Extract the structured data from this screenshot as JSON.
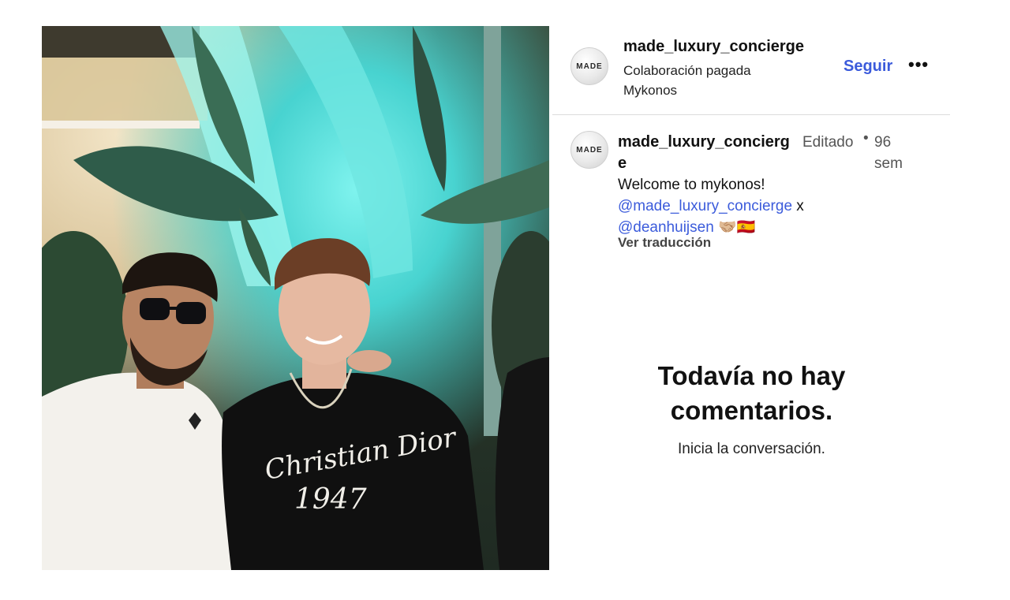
{
  "post": {
    "account": {
      "username": "made_luxury_concierge",
      "avatar_logo": "MADE",
      "paid_partnership": "Colaboración pagada",
      "location": "Mykonos",
      "follow_label": "Seguir",
      "more_label": "•••"
    },
    "caption": {
      "username": "made_luxury_concierge",
      "edited_label": "Editado",
      "dot": "•",
      "time": "96 sem",
      "text_line1": "Welcome to mykonos!",
      "mention1": "@made_luxury_concierge",
      "connector": " x",
      "mention2": "@deanhuijsen",
      "emojis": "🤝🏼🇪🇸",
      "translate_label": "Ver traducción"
    },
    "comments": {
      "empty_title": "Todavía no hay comentarios.",
      "empty_subtitle": "Inicia la conversación."
    },
    "photo": {
      "shirt_print_script": "Christian Dior",
      "shirt_print_year": "1947"
    }
  }
}
